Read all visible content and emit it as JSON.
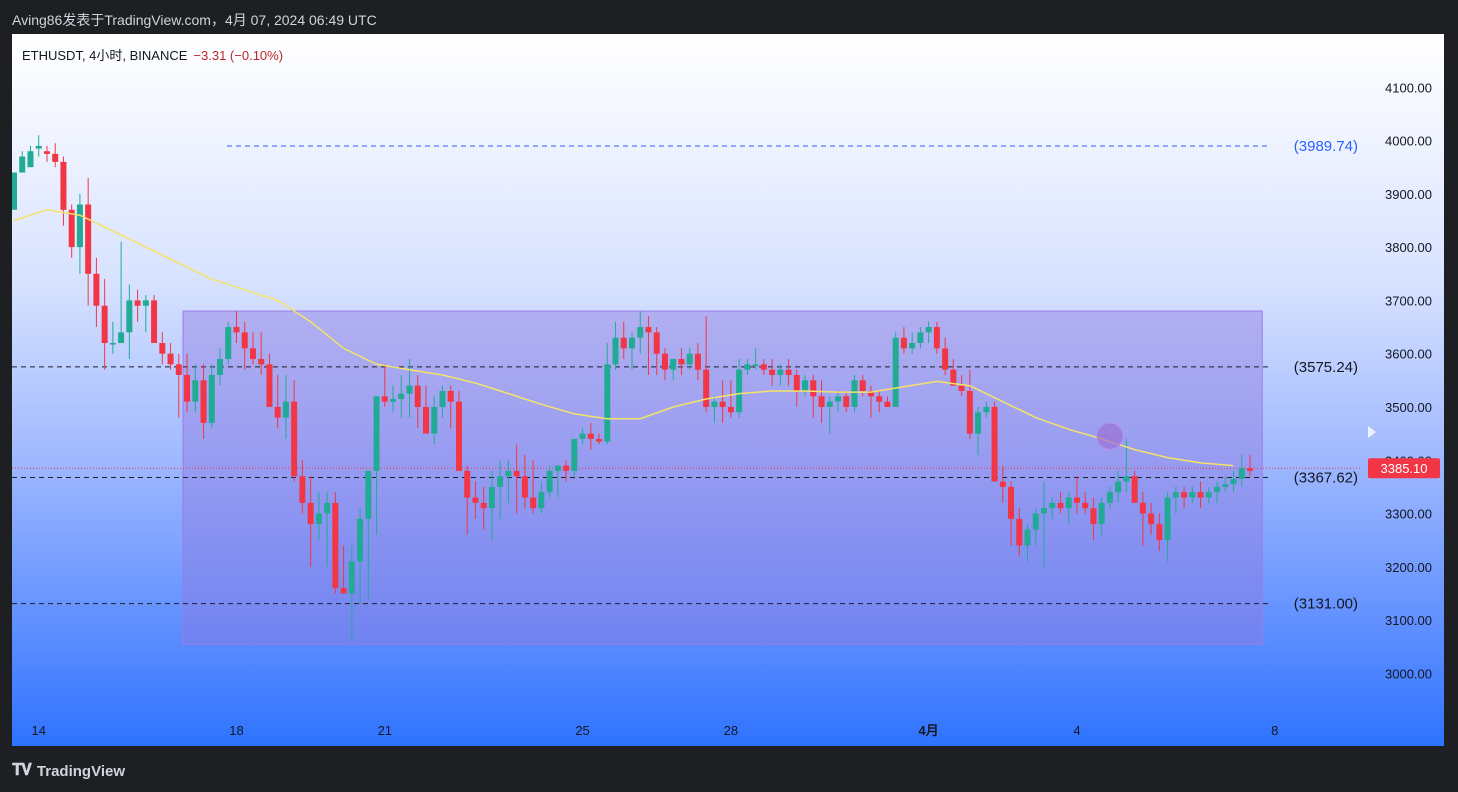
{
  "header": {
    "publish_line": "Aving86发表于TradingView.com，4月 07, 2024 06:49 UTC"
  },
  "legend": {
    "symbol": "ETHUSDT, 4小时, BINANCE",
    "change": "−3.31 (−0.10%)"
  },
  "brand": {
    "logo_icon": "tradingview-logo-icon",
    "name": "TradingView"
  },
  "colors": {
    "up": "#22ab94",
    "down": "#f23645",
    "ma": "#f5e26a",
    "box": "#8f79e0",
    "last_price_bg": "#f23645"
  },
  "chart_data": {
    "type": "candlestick",
    "title": "",
    "price_scale": {
      "ylim": [
        2920,
        4200
      ],
      "ticks": [
        "4100.00",
        "4000.00",
        "3900.00",
        "3800.00",
        "3700.00",
        "3600.00",
        "3500.00",
        "3400.00",
        "3300.00",
        "3200.00",
        "3100.00",
        "3000.00"
      ]
    },
    "time_scale": {
      "labels": [
        {
          "t": "14",
          "i": 3
        },
        {
          "t": "18",
          "i": 27
        },
        {
          "t": "21",
          "i": 45
        },
        {
          "t": "25",
          "i": 69
        },
        {
          "t": "28",
          "i": 87
        },
        {
          "t": "4月",
          "i": 111
        },
        {
          "t": "4",
          "i": 129
        },
        {
          "t": "8",
          "i": 153
        }
      ]
    },
    "horizontal_levels": [
      {
        "price": 3989.74,
        "label": "(3989.74)",
        "style": "dashed-blue"
      },
      {
        "price": 3575.24,
        "label": "(3575.24)",
        "style": "dashed-dark"
      },
      {
        "price": 3367.62,
        "label": "(3367.62)",
        "style": "dashed-dark"
      },
      {
        "price": 3131.0,
        "label": "(3131.00)",
        "style": "dashed-dark"
      }
    ],
    "last_price": {
      "value": 3385.1,
      "label": "3385.10"
    },
    "range_box": {
      "top": 3680,
      "bottom": 3055,
      "i_start": 21,
      "i_end": 151
    },
    "marker_circle": {
      "i": 133,
      "price": 3445
    },
    "candles": [
      [
        3870,
        3940,
        3880,
        3940
      ],
      [
        3940,
        3980,
        3950,
        3970
      ],
      [
        3950,
        3990,
        3950,
        3980
      ],
      [
        3985,
        4010,
        3970,
        3990
      ],
      [
        3980,
        3990,
        3960,
        3975
      ],
      [
        3975,
        3995,
        3950,
        3960
      ],
      [
        3960,
        3970,
        3840,
        3870
      ],
      [
        3870,
        3880,
        3780,
        3800
      ],
      [
        3800,
        3900,
        3750,
        3880
      ],
      [
        3880,
        3930,
        3690,
        3750
      ],
      [
        3750,
        3780,
        3650,
        3690
      ],
      [
        3690,
        3740,
        3570,
        3620
      ],
      [
        3620,
        3660,
        3600,
        3620
      ],
      [
        3620,
        3810,
        3620,
        3640
      ],
      [
        3640,
        3730,
        3590,
        3700
      ],
      [
        3700,
        3720,
        3660,
        3690
      ],
      [
        3690,
        3710,
        3640,
        3700
      ],
      [
        3700,
        3710,
        3620,
        3620
      ],
      [
        3620,
        3640,
        3580,
        3600
      ],
      [
        3600,
        3620,
        3570,
        3580
      ],
      [
        3580,
        3600,
        3480,
        3560
      ],
      [
        3560,
        3600,
        3490,
        3510
      ],
      [
        3510,
        3580,
        3490,
        3550
      ],
      [
        3550,
        3580,
        3440,
        3470
      ],
      [
        3470,
        3580,
        3460,
        3560
      ],
      [
        3560,
        3610,
        3540,
        3590
      ],
      [
        3590,
        3660,
        3580,
        3650
      ],
      [
        3650,
        3680,
        3620,
        3640
      ],
      [
        3640,
        3660,
        3570,
        3610
      ],
      [
        3610,
        3640,
        3580,
        3590
      ],
      [
        3590,
        3640,
        3560,
        3580
      ],
      [
        3580,
        3600,
        3510,
        3500
      ],
      [
        3500,
        3560,
        3460,
        3480
      ],
      [
        3480,
        3560,
        3440,
        3510
      ],
      [
        3510,
        3550,
        3360,
        3370
      ],
      [
        3370,
        3400,
        3300,
        3320
      ],
      [
        3320,
        3370,
        3200,
        3280
      ],
      [
        3280,
        3340,
        3250,
        3300
      ],
      [
        3300,
        3340,
        3200,
        3320
      ],
      [
        3320,
        3340,
        3150,
        3160
      ],
      [
        3160,
        3240,
        3150,
        3150
      ],
      [
        3150,
        3240,
        3060,
        3210
      ],
      [
        3210,
        3310,
        3130,
        3290
      ],
      [
        3290,
        3360,
        3140,
        3380
      ],
      [
        3380,
        3420,
        3260,
        3520
      ],
      [
        3520,
        3580,
        3500,
        3510
      ],
      [
        3510,
        3540,
        3490,
        3515
      ],
      [
        3515,
        3560,
        3480,
        3525
      ],
      [
        3525,
        3590,
        3480,
        3540
      ],
      [
        3540,
        3560,
        3460,
        3500
      ],
      [
        3500,
        3540,
        3470,
        3450
      ],
      [
        3450,
        3520,
        3430,
        3500
      ],
      [
        3500,
        3540,
        3480,
        3530
      ],
      [
        3530,
        3540,
        3460,
        3510
      ],
      [
        3510,
        3530,
        3380,
        3380
      ],
      [
        3380,
        3390,
        3260,
        3330
      ],
      [
        3330,
        3360,
        3290,
        3320
      ],
      [
        3320,
        3350,
        3270,
        3310
      ],
      [
        3310,
        3380,
        3250,
        3350
      ],
      [
        3350,
        3400,
        3290,
        3370
      ],
      [
        3370,
        3400,
        3320,
        3380
      ],
      [
        3380,
        3430,
        3300,
        3370
      ],
      [
        3370,
        3410,
        3310,
        3330
      ],
      [
        3330,
        3400,
        3300,
        3310
      ],
      [
        3310,
        3360,
        3300,
        3340
      ],
      [
        3340,
        3390,
        3330,
        3380
      ],
      [
        3380,
        3390,
        3330,
        3390
      ],
      [
        3390,
        3400,
        3360,
        3380
      ],
      [
        3380,
        3440,
        3370,
        3440
      ],
      [
        3440,
        3460,
        3430,
        3450
      ],
      [
        3450,
        3470,
        3420,
        3440
      ],
      [
        3440,
        3450,
        3430,
        3435
      ],
      [
        3435,
        3620,
        3430,
        3580
      ],
      [
        3580,
        3660,
        3570,
        3630
      ],
      [
        3630,
        3660,
        3590,
        3610
      ],
      [
        3610,
        3640,
        3570,
        3630
      ],
      [
        3630,
        3680,
        3600,
        3650
      ],
      [
        3650,
        3670,
        3560,
        3640
      ],
      [
        3640,
        3650,
        3560,
        3600
      ],
      [
        3600,
        3610,
        3550,
        3570
      ],
      [
        3570,
        3590,
        3550,
        3590
      ],
      [
        3590,
        3610,
        3560,
        3580
      ],
      [
        3580,
        3610,
        3570,
        3600
      ],
      [
        3600,
        3620,
        3550,
        3570
      ],
      [
        3570,
        3670,
        3490,
        3500
      ],
      [
        3500,
        3520,
        3470,
        3510
      ],
      [
        3510,
        3550,
        3470,
        3500
      ],
      [
        3500,
        3550,
        3480,
        3490
      ],
      [
        3490,
        3590,
        3480,
        3570
      ],
      [
        3570,
        3590,
        3560,
        3580
      ],
      [
        3580,
        3610,
        3570,
        3580
      ],
      [
        3580,
        3590,
        3560,
        3570
      ],
      [
        3570,
        3590,
        3540,
        3560
      ],
      [
        3560,
        3580,
        3540,
        3570
      ],
      [
        3570,
        3590,
        3540,
        3560
      ],
      [
        3560,
        3570,
        3500,
        3530
      ],
      [
        3530,
        3560,
        3520,
        3550
      ],
      [
        3550,
        3560,
        3480,
        3520
      ],
      [
        3520,
        3550,
        3470,
        3500
      ],
      [
        3500,
        3520,
        3450,
        3510
      ],
      [
        3510,
        3530,
        3490,
        3520
      ],
      [
        3520,
        3530,
        3490,
        3500
      ],
      [
        3500,
        3560,
        3490,
        3550
      ],
      [
        3550,
        3560,
        3520,
        3530
      ],
      [
        3530,
        3540,
        3480,
        3520
      ],
      [
        3520,
        3530,
        3490,
        3510
      ],
      [
        3510,
        3520,
        3500,
        3500
      ],
      [
        3500,
        3640,
        3500,
        3630
      ],
      [
        3630,
        3650,
        3600,
        3610
      ],
      [
        3610,
        3640,
        3600,
        3620
      ],
      [
        3620,
        3650,
        3610,
        3640
      ],
      [
        3640,
        3660,
        3620,
        3650
      ],
      [
        3650,
        3660,
        3600,
        3610
      ],
      [
        3610,
        3630,
        3560,
        3570
      ],
      [
        3570,
        3590,
        3540,
        3540
      ],
      [
        3540,
        3560,
        3520,
        3530
      ],
      [
        3530,
        3570,
        3440,
        3450
      ],
      [
        3450,
        3500,
        3410,
        3490
      ],
      [
        3490,
        3510,
        3480,
        3500
      ],
      [
        3500,
        3510,
        3360,
        3360
      ],
      [
        3360,
        3390,
        3320,
        3350
      ],
      [
        3350,
        3360,
        3240,
        3290
      ],
      [
        3290,
        3310,
        3220,
        3240
      ],
      [
        3240,
        3280,
        3210,
        3270
      ],
      [
        3270,
        3310,
        3240,
        3300
      ],
      [
        3300,
        3360,
        3200,
        3310
      ],
      [
        3310,
        3330,
        3290,
        3320
      ],
      [
        3320,
        3340,
        3300,
        3310
      ],
      [
        3310,
        3340,
        3280,
        3330
      ],
      [
        3330,
        3370,
        3300,
        3320
      ],
      [
        3320,
        3340,
        3300,
        3310
      ],
      [
        3310,
        3330,
        3250,
        3280
      ],
      [
        3280,
        3330,
        3260,
        3320
      ],
      [
        3320,
        3350,
        3310,
        3340
      ],
      [
        3340,
        3380,
        3320,
        3360
      ],
      [
        3360,
        3440,
        3340,
        3370
      ],
      [
        3370,
        3380,
        3320,
        3320
      ],
      [
        3320,
        3340,
        3240,
        3300
      ],
      [
        3300,
        3320,
        3260,
        3280
      ],
      [
        3280,
        3300,
        3230,
        3250
      ],
      [
        3250,
        3340,
        3210,
        3330
      ],
      [
        3330,
        3350,
        3300,
        3340
      ],
      [
        3340,
        3350,
        3310,
        3330
      ],
      [
        3330,
        3350,
        3320,
        3340
      ],
      [
        3340,
        3360,
        3310,
        3330
      ],
      [
        3330,
        3350,
        3320,
        3340
      ],
      [
        3340,
        3360,
        3320,
        3350
      ],
      [
        3350,
        3370,
        3340,
        3355
      ],
      [
        3355,
        3380,
        3340,
        3365
      ],
      [
        3365,
        3410,
        3350,
        3385
      ],
      [
        3385,
        3410,
        3370,
        3380
      ]
    ],
    "moving_average": [
      [
        0,
        3850
      ],
      [
        4,
        3870
      ],
      [
        8,
        3860
      ],
      [
        12,
        3830
      ],
      [
        16,
        3800
      ],
      [
        20,
        3770
      ],
      [
        24,
        3740
      ],
      [
        28,
        3720
      ],
      [
        32,
        3700
      ],
      [
        36,
        3660
      ],
      [
        40,
        3610
      ],
      [
        44,
        3580
      ],
      [
        48,
        3570
      ],
      [
        52,
        3560
      ],
      [
        56,
        3545
      ],
      [
        60,
        3525
      ],
      [
        64,
        3505
      ],
      [
        68,
        3487
      ],
      [
        72,
        3478
      ],
      [
        76,
        3478
      ],
      [
        80,
        3500
      ],
      [
        84,
        3515
      ],
      [
        88,
        3525
      ],
      [
        92,
        3530
      ],
      [
        96,
        3530
      ],
      [
        100,
        3528
      ],
      [
        104,
        3528
      ],
      [
        108,
        3538
      ],
      [
        112,
        3548
      ],
      [
        116,
        3540
      ],
      [
        120,
        3510
      ],
      [
        124,
        3480
      ],
      [
        128,
        3458
      ],
      [
        132,
        3440
      ],
      [
        136,
        3420
      ],
      [
        140,
        3405
      ],
      [
        144,
        3395
      ],
      [
        148,
        3390
      ]
    ]
  }
}
